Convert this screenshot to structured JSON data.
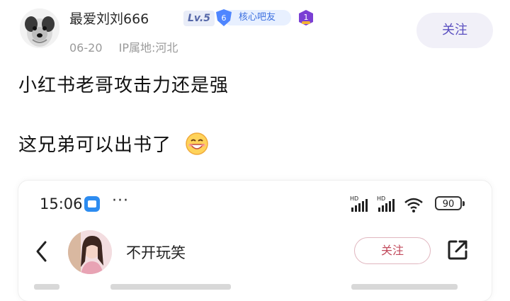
{
  "post": {
    "username": "最爱刘刘666",
    "level_badge": "Lv.5",
    "core_level": "6",
    "core_badge": "核心吧友",
    "member_badge_num": "1",
    "date": "06-20",
    "ip_location": "IP属地:河北",
    "follow_label": "关注",
    "content_line1": "小红书老哥攻击力还是强",
    "content_line2": "这兄弟可以出书了"
  },
  "screenshot": {
    "status_time": "15:06",
    "status_dots": "···",
    "signal_label_1": "HD",
    "signal_label_2": "HD",
    "battery": "90",
    "profile_name": "不开玩笑",
    "follow_label": "关注"
  },
  "colors": {
    "follow_text": "#5a4fc0",
    "badge_blue": "#3b6fe0",
    "member_purple": "#7a3fd4",
    "pink_accent": "#c24a5c"
  },
  "icons": {
    "avatar": "dog-avatar",
    "emoji": "grinning-face-emoji",
    "back": "chevron-left-icon",
    "share": "share-icon",
    "wifi": "wifi-icon",
    "signal": "signal-bars-icon"
  }
}
